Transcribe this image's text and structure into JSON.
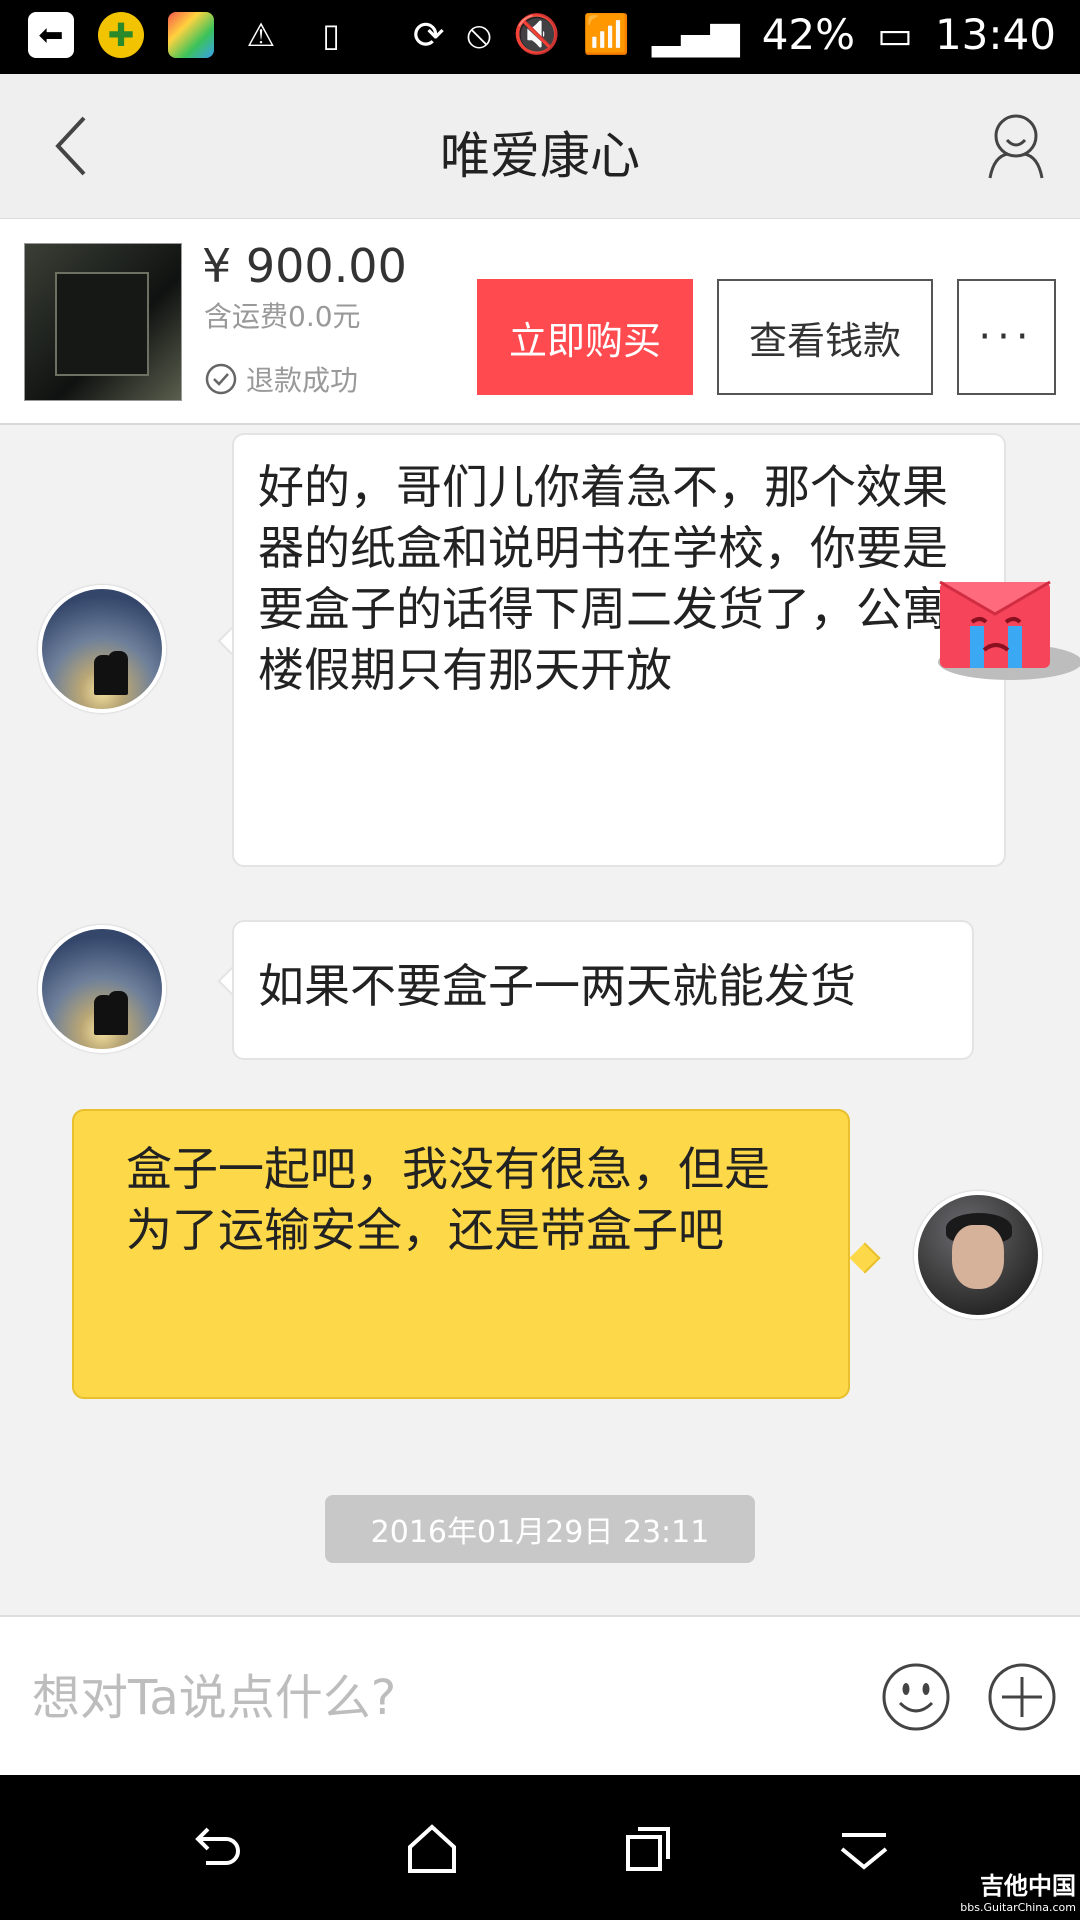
{
  "status_bar": {
    "battery": "42%",
    "time": "13:40"
  },
  "header": {
    "title": "唯爱康心"
  },
  "product": {
    "price": "¥ 900.00",
    "shipping": "含运费0.0元",
    "status": "退款成功",
    "buy_label": "立即购买",
    "view_label": "查看钱款",
    "more_label": "···"
  },
  "messages": [
    {
      "from": "seller",
      "text": "好的，哥们儿你着急不，那个效果器的纸盒和说明书在学校，你要是要盒子的话得下周二发货了，公寓楼假期只有那天开放"
    },
    {
      "from": "seller",
      "text": "如果不要盒子一两天就能发货"
    },
    {
      "from": "me",
      "text": "盒子一起吧，我没有很急，但是为了运输安全，还是带盒子吧"
    }
  ],
  "timestamp": "2016年01月29日 23:11",
  "composer": {
    "placeholder": "想对Ta说点什么?"
  },
  "watermark": {
    "line1": "吉他中国",
    "line2": "bbs.GuitarChina.com"
  },
  "colors": {
    "buy_button": "#ff4a4f",
    "my_bubble": "#fdd94a",
    "header_bg": "#efefef"
  }
}
